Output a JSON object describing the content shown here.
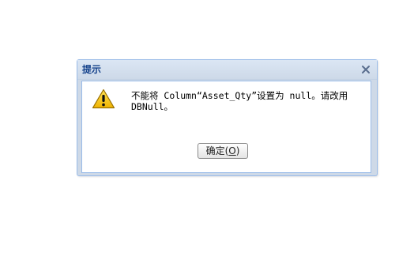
{
  "dialog": {
    "title": "提示",
    "close_glyph": "×",
    "icon": "warning-icon",
    "message_line1": "不能将 Column“Asset_Qty”设置为 null。请改用",
    "message_line2": "DBNull。",
    "ok": {
      "prefix": "确定(",
      "mnemonic": "O",
      "suffix": ")"
    }
  },
  "colors": {
    "title_text": "#15428b",
    "frame_border": "#99bbe8",
    "warning_fill": "#f5c400"
  }
}
